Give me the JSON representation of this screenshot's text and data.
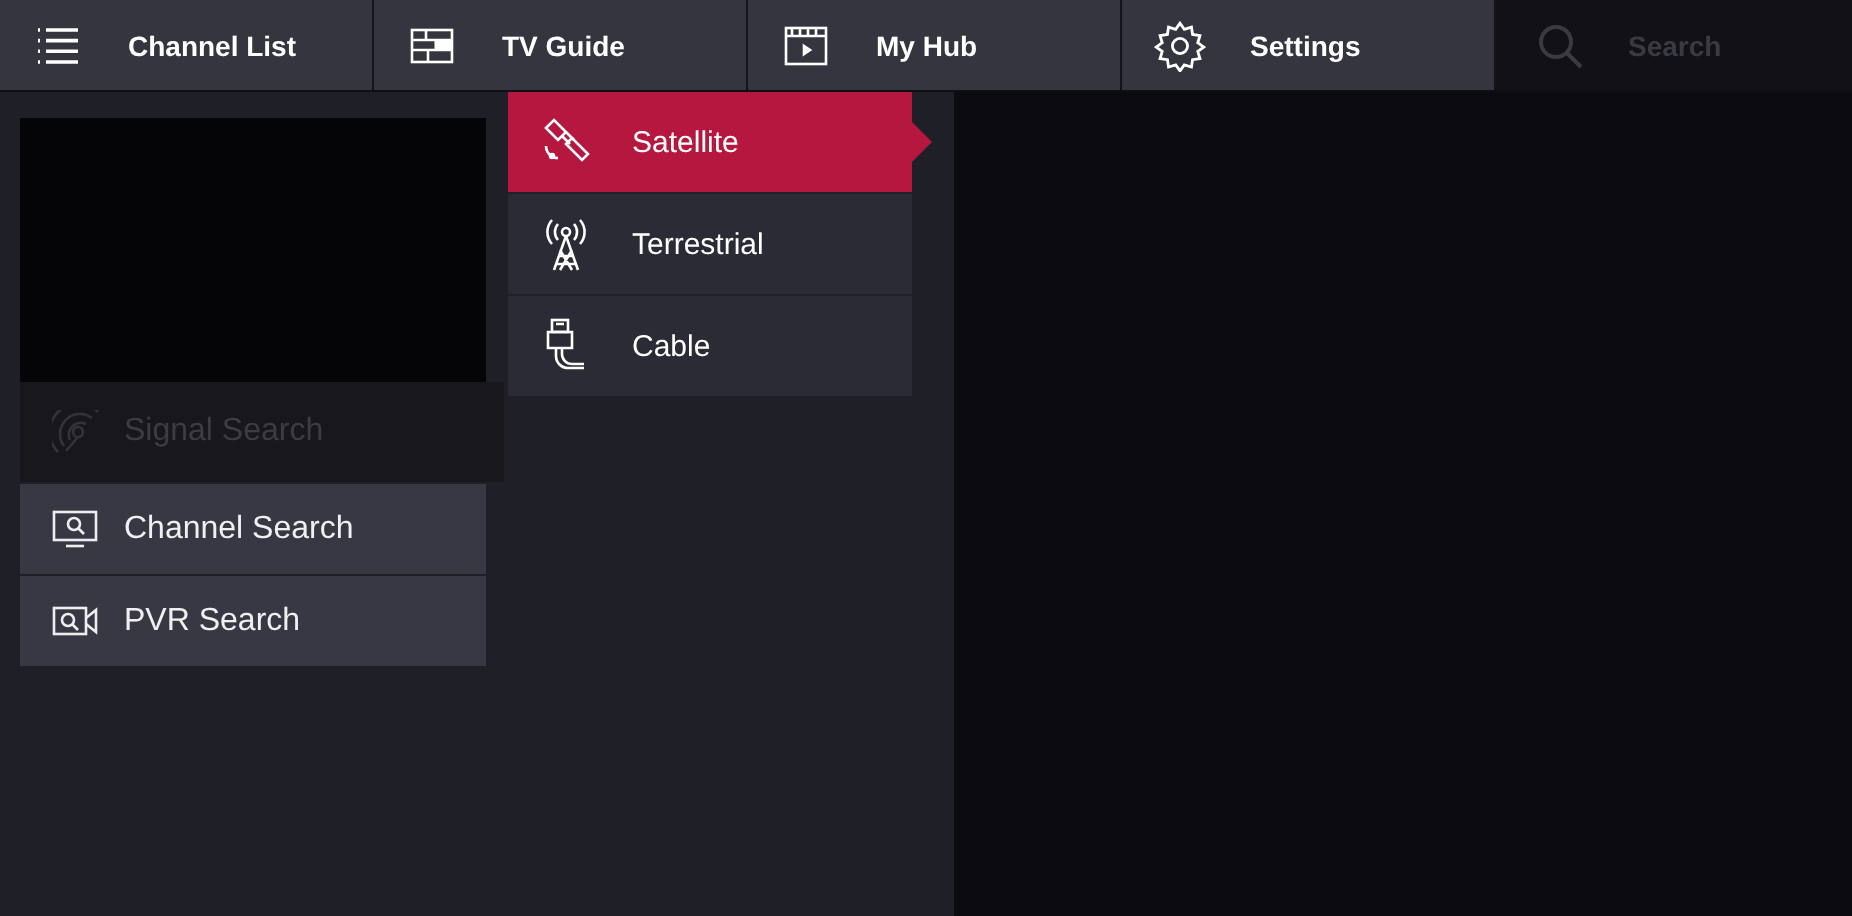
{
  "nav_tabs": [
    {
      "label": "Channel List"
    },
    {
      "label": "TV Guide"
    },
    {
      "label": "My Hub"
    },
    {
      "label": "Settings"
    }
  ],
  "search": {
    "placeholder": "Search"
  },
  "menu": [
    {
      "label": "Signal Search",
      "disabled": true
    },
    {
      "label": "Channel Search",
      "disabled": false
    },
    {
      "label": "PVR Search",
      "disabled": false
    }
  ],
  "submenu": [
    {
      "label": "Satellite",
      "selected": true
    },
    {
      "label": "Terrestrial",
      "selected": false
    },
    {
      "label": "Cable",
      "selected": false
    }
  ]
}
